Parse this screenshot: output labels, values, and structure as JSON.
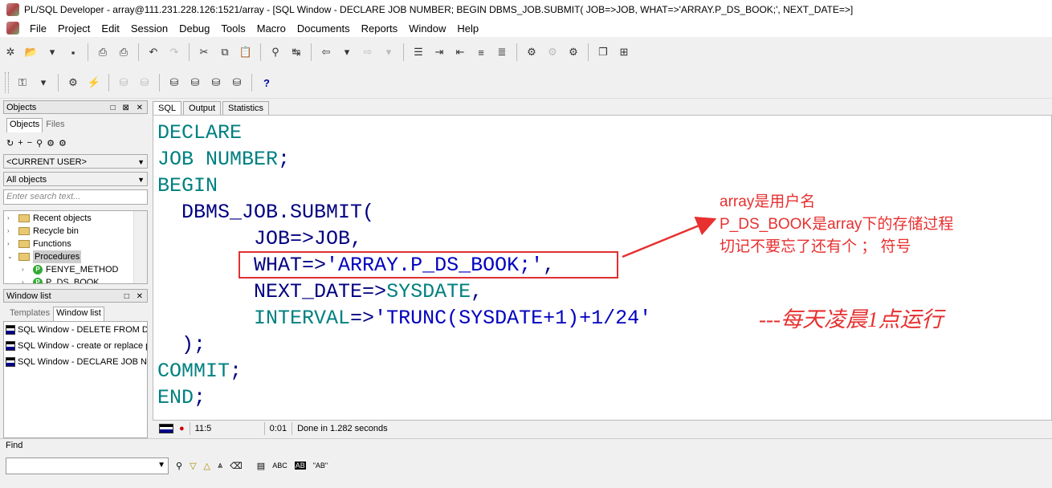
{
  "window": {
    "title": "PL/SQL Developer - array@111.231.228.126:1521/array - [SQL Window - DECLARE JOB NUMBER; BEGIN DBMS_JOB.SUBMIT( JOB=>JOB, WHAT=>'ARRAY.P_DS_BOOK;', NEXT_DATE=>]"
  },
  "menu": [
    "File",
    "Project",
    "Edit",
    "Session",
    "Debug",
    "Tools",
    "Macro",
    "Documents",
    "Reports",
    "Window",
    "Help"
  ],
  "objects_panel": {
    "title": "Objects",
    "controls": "□ ⊠ ✕",
    "tabs": [
      "Objects",
      "Files"
    ],
    "user_combo": "<CURRENT USER>",
    "filter_combo": "All objects",
    "search_placeholder": "Enter search text...",
    "tree": [
      {
        "label": "Recent objects",
        "expander": "›"
      },
      {
        "label": "Recycle bin",
        "expander": "›"
      },
      {
        "label": "Functions",
        "expander": "›"
      },
      {
        "label": "Procedures",
        "expander": "⌄"
      },
      {
        "label": "FENYE_METHOD",
        "expander": "›"
      },
      {
        "label": "P_DS_BOOK",
        "expander": "›"
      }
    ]
  },
  "window_panel": {
    "title": "Window list",
    "controls": "□ ✕",
    "tabs": [
      "Templates",
      "Window list"
    ],
    "items": [
      "SQL Window - DELETE FROM DS",
      "SQL Window - create or replace pr",
      "SQL Window - DECLARE JOB NU"
    ]
  },
  "editor": {
    "tabs": [
      "SQL",
      "Output",
      "Statistics"
    ],
    "code": {
      "l1": "DECLARE",
      "l2a": "JOB",
      "l2b": " NUMBER",
      "l2c": ";",
      "l3": "BEGIN",
      "l4a": "  DBMS_JOB.SUBMIT",
      "l4b": "(",
      "l5a": "        JOB",
      "l5b": "=>",
      "l5c": "JOB",
      "l5d": ",",
      "l6a": "        WHAT",
      "l6b": "=>",
      "l6c": "'ARRAY.P_DS_BOOK;'",
      "l6d": ",",
      "l7a": "        NEXT_DATE",
      "l7b": "=>",
      "l7c": "SYSDATE",
      "l7d": ",",
      "l8a": "        INTERVAL",
      "l8b": "=>",
      "l8c": "'TRUNC(SYSDATE+1)+1/24'",
      "l9": "  );",
      "l10a": "COMMIT",
      "l10b": ";",
      "l11a": "END",
      "l11b": ";"
    },
    "annotation": {
      "line1": "array是用户名",
      "line2": "P_DS_BOOK是array下的存储过程",
      "line3": "切记不要忘了还有个 ；  符号",
      "comment": "---每天凌晨1点运行"
    }
  },
  "status": {
    "position": "11:5",
    "elapsed": "0:01",
    "message": "Done in 1.282 seconds"
  },
  "find": {
    "label": "Find",
    "buttons": [
      "ABC",
      "AB",
      "\"AB\""
    ]
  },
  "colors": {
    "keyword": "#008080",
    "identifier": "#000080",
    "string": "#0000c0",
    "annotation": "#e83030"
  }
}
